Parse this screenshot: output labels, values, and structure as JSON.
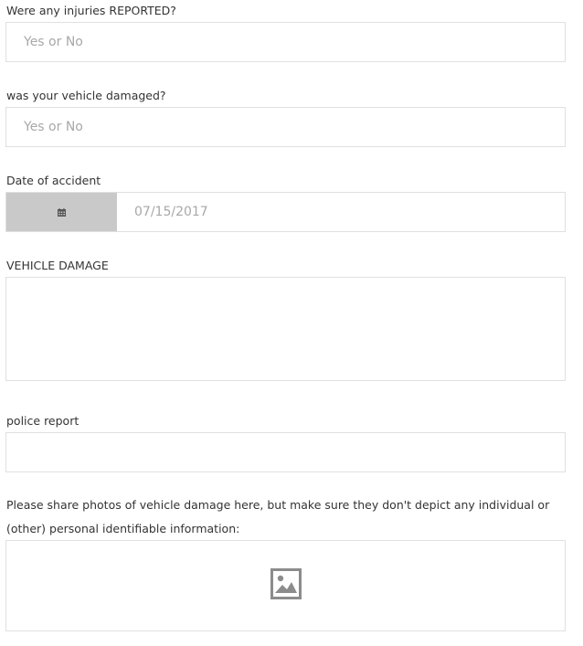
{
  "fields": {
    "injuries": {
      "label": "Were any injuries REPORTED?",
      "placeholder": "Yes or No",
      "value": ""
    },
    "vehicle_damaged": {
      "label": "was your vehicle damaged?",
      "placeholder": "Yes or No",
      "value": ""
    },
    "date_of_accident": {
      "label": "Date of accident",
      "placeholder": "07/15/2017",
      "value": "",
      "icon": "calendar-icon"
    },
    "vehicle_damage": {
      "label": "VEHICLE DAMAGE",
      "value": ""
    },
    "police_report": {
      "label": "police report",
      "value": ""
    },
    "photos": {
      "label_line1": "Please share photos of vehicle damage here, but make sure they don't depict any individual or",
      "label_line2": "(other) personal identifiable information:",
      "icon": "image-icon"
    }
  },
  "colors": {
    "border": "#e0e0e0",
    "date_button_bg": "#c9c9c9",
    "placeholder": "#a8a8a8",
    "icon": "#8c8c8c",
    "calendar_icon": "#555555"
  }
}
